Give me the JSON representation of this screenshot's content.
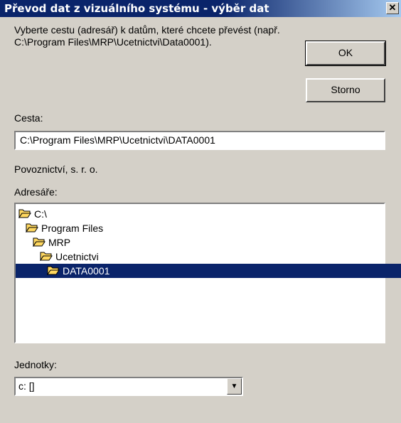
{
  "window": {
    "title": "Převod dat z vizuálního systému - výběr dat"
  },
  "description": "Vyberte cestu (adresář) k datům, které chcete převést (např. C:\\Program Files\\MRP\\Ucetnictvi\\Data0001).",
  "buttons": {
    "ok": "OK",
    "storno": "Storno"
  },
  "path": {
    "label": "Cesta:",
    "value": "C:\\Program Files\\MRP\\Ucetnictvi\\DATA0001"
  },
  "company": "Povoznictví, s. r. o.",
  "directories": {
    "label": "Adresáře:",
    "items": [
      {
        "label": "C:\\",
        "selected": false,
        "open": true
      },
      {
        "label": "Program Files",
        "selected": false,
        "open": true
      },
      {
        "label": "MRP",
        "selected": false,
        "open": true
      },
      {
        "label": "Ucetnictvi",
        "selected": false,
        "open": true
      },
      {
        "label": "DATA0001",
        "selected": true,
        "open": true
      }
    ]
  },
  "drives": {
    "label": "Jednotky:",
    "value": "c: []"
  },
  "colors": {
    "titlebar": "#0a246a",
    "selection": "#0a246a",
    "face": "#d4d0c8",
    "folder": "#ffd860"
  }
}
